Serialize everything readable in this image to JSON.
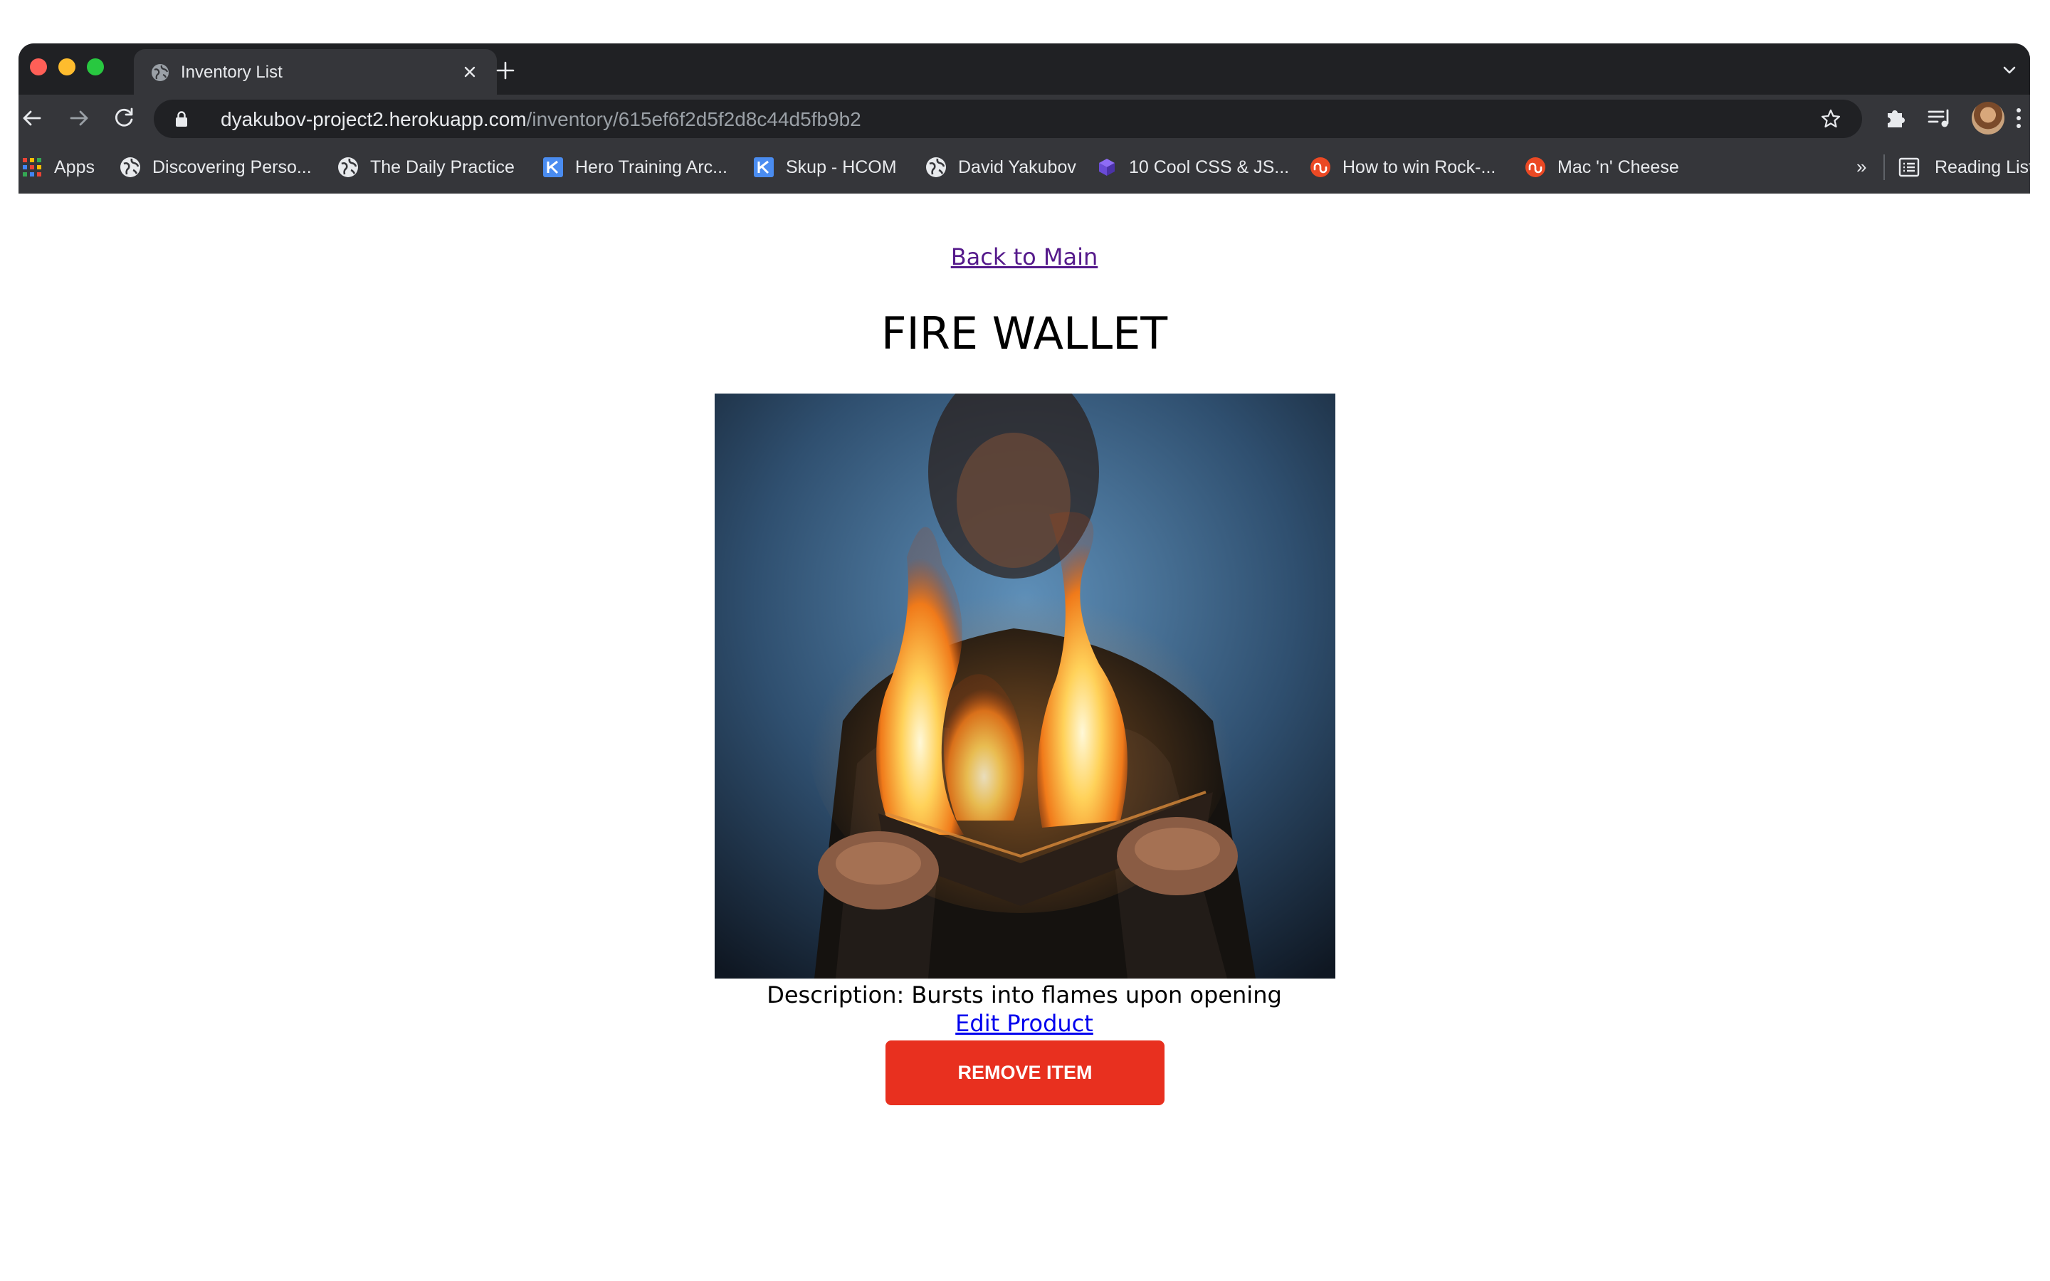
{
  "browser": {
    "tab": {
      "title": "Inventory List",
      "favicon": "globe-icon"
    },
    "address_bar": {
      "host": "dyakubov-project2.herokuapp.com",
      "path": "/inventory/615ef6f2d5f2d8c44d5fb9b2"
    },
    "bookmarks": [
      {
        "label": "Apps",
        "icon": "apps-grid-icon"
      },
      {
        "label": "Discovering Perso...",
        "icon": "globe-icon"
      },
      {
        "label": "The Daily Practice",
        "icon": "globe-icon"
      },
      {
        "label": "Hero Training Arc...",
        "icon": "k-logo-icon"
      },
      {
        "label": "Skup - HCOM",
        "icon": "k-logo-icon"
      },
      {
        "label": "David Yakubov",
        "icon": "globe-icon"
      },
      {
        "label": "10 Cool CSS & JS...",
        "icon": "codepen-icon"
      },
      {
        "label": "How to win Rock-...",
        "icon": "stumbleupon-icon"
      },
      {
        "label": "Mac 'n' Cheese",
        "icon": "stumbleupon-icon"
      }
    ],
    "overflow_label": "»",
    "reading_list_label": "Reading List"
  },
  "page": {
    "back_link": "Back to Main",
    "product_name": "FIRE WALLET",
    "image": "man holding a burning wallet",
    "description": "Description: Bursts into flames upon opening",
    "edit_link": "Edit Product",
    "remove_button": "Remove Item"
  },
  "colors": {
    "remove_button": "#e8301f",
    "visited_link": "#551a8b",
    "link": "#0000ee",
    "chrome_dark": "#202124",
    "chrome_toolbar": "#35363a"
  }
}
